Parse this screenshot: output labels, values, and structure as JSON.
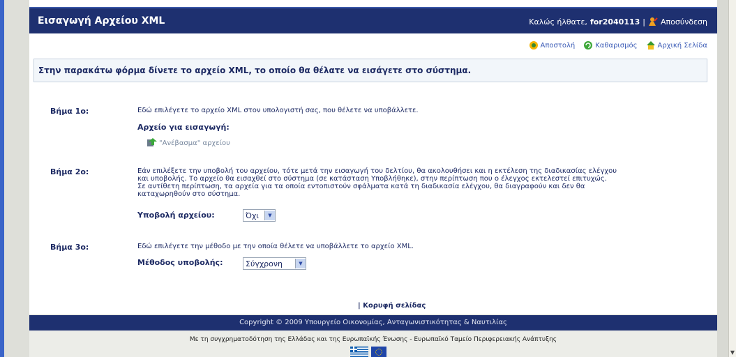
{
  "header": {
    "title": "Εισαγωγή Αρχείου XML",
    "welcome_prefix": "Καλώς ήλθατε,",
    "username": "for2040113",
    "separator": "|",
    "logout": "Αποσύνδεση"
  },
  "toolbar": {
    "send": "Αποστολή",
    "clear": "Καθαρισμός",
    "home": "Αρχική Σελίδα"
  },
  "info": "Στην παρακάτω φόρμα δίνετε το αρχείο XML, το οποίο θα θέλατε να εισάγετε στο σύστημα.",
  "steps": {
    "step1": {
      "label": "Βήμα 1ο:",
      "text": "Εδώ επιλέγετε το αρχείο XML στον υπολογιστή σας, που θέλετε να υποβάλλετε.",
      "field_label": "Αρχείο για εισαγωγή:",
      "upload_link": "\"Ανέβασμα\" αρχείου"
    },
    "step2": {
      "label": "Βήμα 2ο:",
      "text_line1": "Εάν επιλέξετε την υποβολή του αρχείου, τότε μετά την εισαγωγή του δελτίου, θα ακολουθήσει και η εκτέλεση της διαδικασίας ελέγχου",
      "text_line2": "και υποβολής. Το αρχείο θα εισαχθεί στο σύστημα (σε κατάσταση Υποβλήθηκε), στην περίπτωση που ο έλεγχος εκτελεστεί επιτυχώς.",
      "text_line3": "Σε αντίθετη περίπτωση, τα αρχεία για τα οποία εντοπιστούν σφάλματα κατά τη διαδικασία ελέγχου, θα διαγραφούν και δεν θα",
      "text_line4": "καταχωρηθούν στο σύστημα.",
      "field_label": "Υποβολή αρχείου:",
      "select_value": "Όχι"
    },
    "step3": {
      "label": "Βήμα 3ο:",
      "text": "Εδώ επιλέγετε την μέθοδο με την οποία θέλετε να υποβάλλετε το αρχείο XML.",
      "field_label": "Μέθοδος υποβολής:",
      "select_value": "Σύγχρονη"
    }
  },
  "top_link": "| Κορυφή σελίδας",
  "footer": {
    "copyright": "Copyright © 2009 Υπουργείο Οικονομίας, Ανταγωνιστικότητας & Ναυτιλίας",
    "cofunding": "Με τη συγχρηματοδότηση της Ελλάδας και της Ευρωπαϊκής Ένωσης - Ευρωπαϊκό Ταμείο Περιφερειακής Ανάπτυξης"
  },
  "colors": {
    "header_bg": "#1e3070",
    "link": "#3b5bb6",
    "text": "#1d2a63"
  }
}
